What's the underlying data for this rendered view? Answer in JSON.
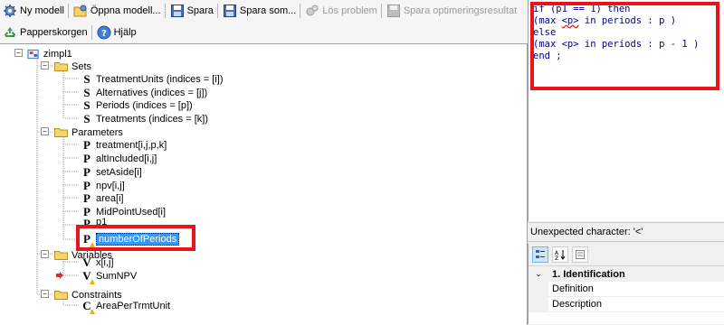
{
  "toolbar": {
    "new_model": "Ny modell",
    "open_model": "Öppna modell...",
    "save": "Spara",
    "save_as": "Spara som...",
    "solve": "Lös problem",
    "save_results": "Spara optimeringsresultat",
    "recycle_bin": "Papperskorgen",
    "help": "Hjälp"
  },
  "tree": {
    "root": "zimpl1",
    "sets_label": "Sets",
    "sets": [
      {
        "letter": "S",
        "label": "TreatmentUnits (indices = [i])"
      },
      {
        "letter": "S",
        "label": "Alternatives (indices = [j])"
      },
      {
        "letter": "S",
        "label": "Periods (indices = [p])"
      },
      {
        "letter": "S",
        "label": "Treatments (indices = [k])"
      }
    ],
    "parameters_label": "Parameters",
    "parameters": [
      {
        "letter": "P",
        "label": "treatment[i,j,p,k]"
      },
      {
        "letter": "P",
        "label": "altIncluded[i,j]"
      },
      {
        "letter": "P",
        "label": "setAside[i]"
      },
      {
        "letter": "P",
        "label": "npv[i,j]"
      },
      {
        "letter": "P",
        "label": "area[i]"
      },
      {
        "letter": "P",
        "label": "MidPointUsed[i]"
      },
      {
        "letter": "P",
        "label": "p1"
      },
      {
        "letter": "P",
        "label": "numberOfPeriods"
      }
    ],
    "variables_label": "Variables",
    "variables": [
      {
        "letter": "V",
        "label": "x[i,j]"
      },
      {
        "letter": "V",
        "label": "SumNPV"
      }
    ],
    "constraints_label": "Constraints",
    "constraints": [
      {
        "letter": "C",
        "label": "AreaPerTrmtUnit"
      }
    ]
  },
  "editor": {
    "line1a": "if (p1 == 1) then",
    "line2a": "(max ",
    "line2b": "<p>",
    "line2c": " in periods : p )",
    "line3": "else",
    "line4": "(max <p> in periods : p - 1 )",
    "line5": "end ;"
  },
  "error_message": "Unexpected character: '<'",
  "properties": {
    "category": "1. Identification",
    "rows": [
      "Definition",
      "Description"
    ]
  },
  "colors": {
    "highlight_box": "#e8141b",
    "selection": "#3399ff",
    "code_text": "#00008b"
  }
}
